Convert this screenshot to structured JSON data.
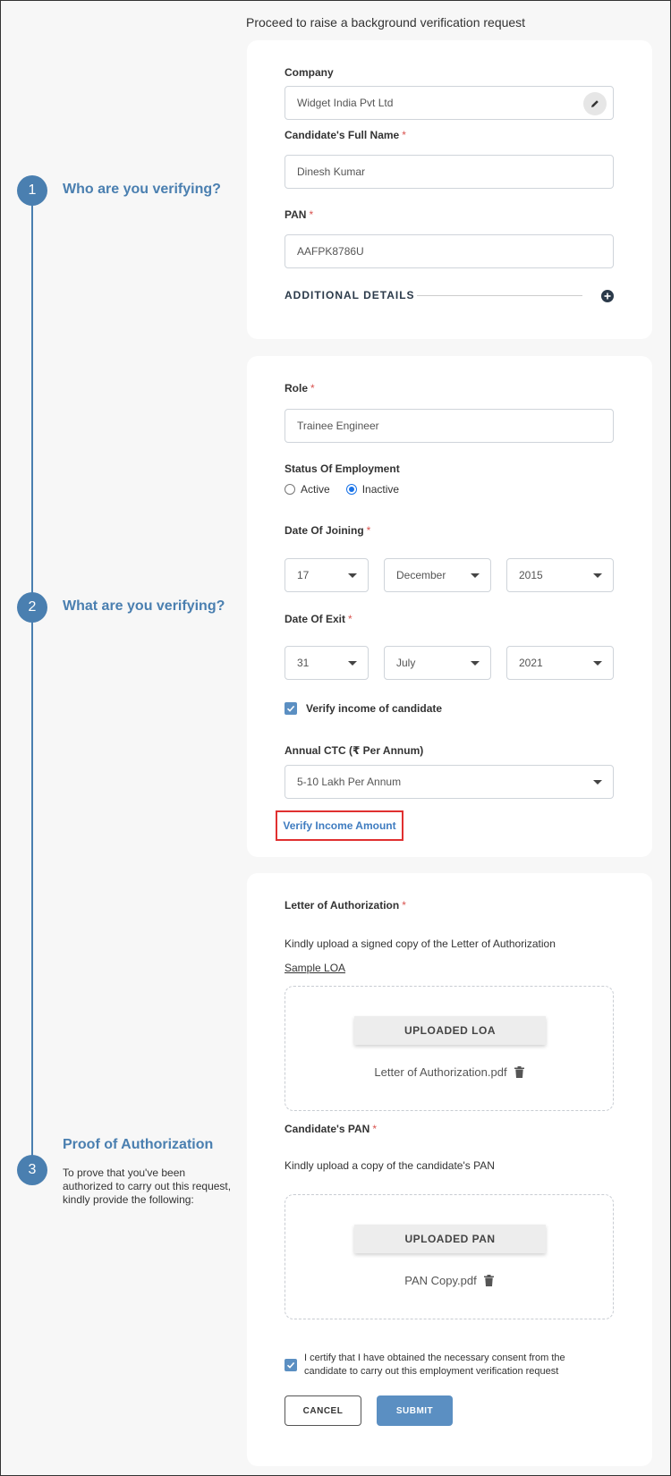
{
  "header": {
    "subtitle": "Proceed to raise a background verification request"
  },
  "steps": [
    {
      "number": "1",
      "title": "Who are you verifying?"
    },
    {
      "number": "2",
      "title": "What are you verifying?"
    },
    {
      "number": "3",
      "title": "Proof of Authorization",
      "description": "To prove that you've been authorized to carry out this request, kindly provide the following:"
    }
  ],
  "who": {
    "company_label": "Company",
    "company_value": "Widget India Pvt Ltd",
    "name_label": "Candidate's Full Name",
    "name_value": "Dinesh Kumar",
    "pan_label": "PAN",
    "pan_value": "AAFPK8786U",
    "additional_details": "ADDITIONAL DETAILS",
    "required_mark": "*"
  },
  "what": {
    "role_label": "Role",
    "role_value": "Trainee Engineer",
    "status_label": "Status Of Employment",
    "status_options": [
      "Active",
      "Inactive"
    ],
    "status_selected": "Inactive",
    "doj_label": "Date Of Joining",
    "doj": {
      "day": "17",
      "month": "December",
      "year": "2015"
    },
    "doe_label": "Date Of Exit",
    "doe": {
      "day": "31",
      "month": "July",
      "year": "2021"
    },
    "verify_income_label": "Verify income of candidate",
    "verify_income_checked": true,
    "ctc_label": "Annual CTC (₹ Per Annum)",
    "ctc_value": "5-10 Lakh Per Annum",
    "verify_income_amount": "Verify Income Amount",
    "required_mark": "*"
  },
  "proof": {
    "loa_label": "Letter of Authorization",
    "loa_help": "Kindly upload a signed copy of the Letter of Authorization",
    "sample_loa": "Sample LOA",
    "loa_button": "UPLOADED LOA",
    "loa_file": "Letter of Authorization.pdf",
    "pan_label": "Candidate's PAN",
    "pan_help": "Kindly upload a copy of the candidate's PAN",
    "pan_button": "UPLOADED PAN",
    "pan_file": "PAN Copy.pdf",
    "certify_text": "I certify that I have obtained the necessary consent from the candidate to carry out this employment verification request",
    "certify_checked": true,
    "cancel": "CANCEL",
    "submit": "SUBMIT",
    "required_mark": "*"
  },
  "colors": {
    "accent": "#4a7fb0",
    "required": "#d9534f",
    "highlight_border": "#e03030"
  }
}
